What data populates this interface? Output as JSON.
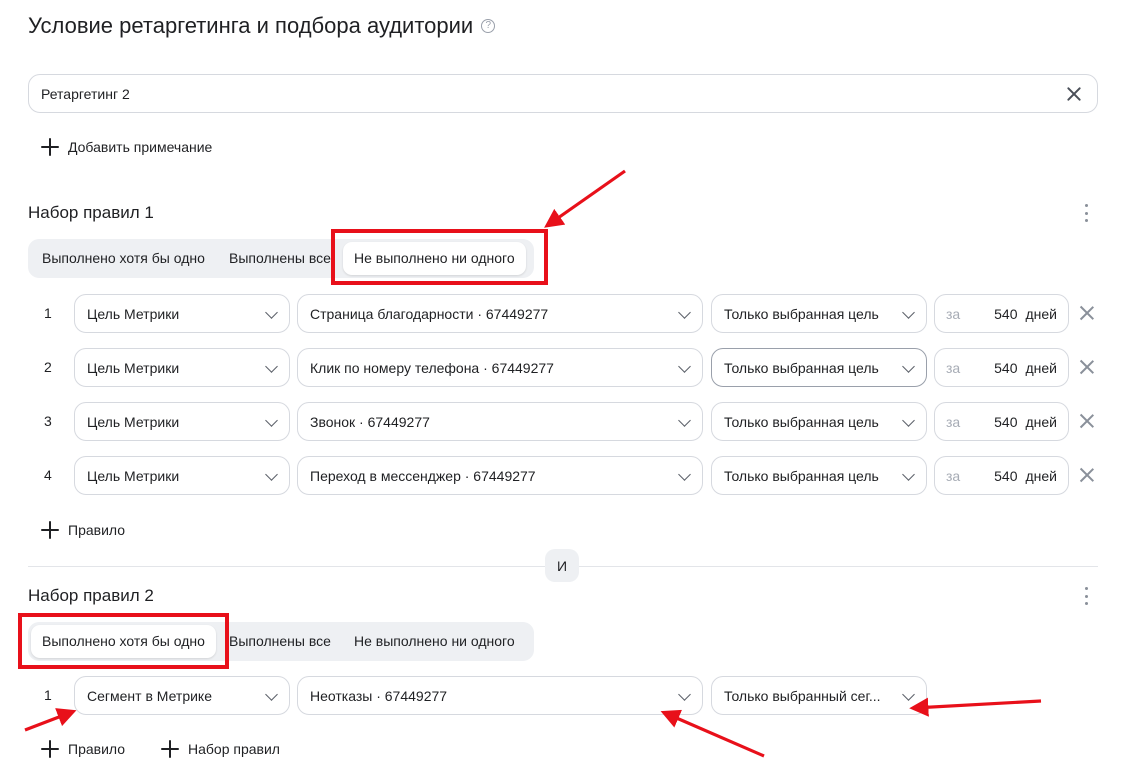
{
  "page": {
    "title": "Условие ретаргетинга и подбора аудитории",
    "help_icon": "question-circle-icon"
  },
  "name_field": {
    "value": "Ретаргетинг 2",
    "clear_icon": "close-icon"
  },
  "add_note": {
    "label": "Добавить примечание"
  },
  "rule_sets": [
    {
      "title": "Набор правил 1",
      "modes": [
        "Выполнено хотя бы одно",
        "Выполнены все",
        "Не выполнено ни одного"
      ],
      "active_mode": "Не выполнено ни одного",
      "rules": [
        {
          "num": "1",
          "type": "Цель Метрики",
          "goal": "Страница благодарности · 67449277",
          "scope": "Только выбранная цель",
          "za": "за",
          "days": "540",
          "unit": "дней"
        },
        {
          "num": "2",
          "type": "Цель Метрики",
          "goal": "Клик по номеру телефона · 67449277",
          "scope": "Только выбранная цель",
          "za": "за",
          "days": "540",
          "unit": "дней"
        },
        {
          "num": "3",
          "type": "Цель Метрики",
          "goal": "Звонок · 67449277",
          "scope": "Только выбранная цель",
          "za": "за",
          "days": "540",
          "unit": "дней"
        },
        {
          "num": "4",
          "type": "Цель Метрики",
          "goal": "Переход в мессенджер · 67449277",
          "scope": "Только выбранная цель",
          "za": "за",
          "days": "540",
          "unit": "дней"
        }
      ],
      "add_rule": "Правило"
    },
    {
      "title": "Набор правил 2",
      "modes": [
        "Выполнено хотя бы одно",
        "Выполнены все",
        "Не выполнено ни одного"
      ],
      "active_mode": "Выполнено хотя бы одно",
      "rules": [
        {
          "num": "1",
          "type": "Сегмент в Метрике",
          "goal": "Неотказы · 67449277",
          "scope": "Только выбранный сег..."
        }
      ],
      "add_rule": "Правило",
      "add_set": "Набор правил"
    }
  ],
  "connector": "И",
  "annotation_color": "#e8101a"
}
